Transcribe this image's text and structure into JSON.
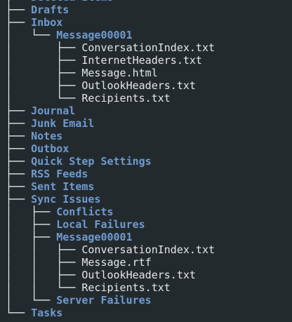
{
  "colors": {
    "background": "#232a2e",
    "directory": "#6f9bd1",
    "file": "#e6e6e6"
  },
  "tree": [
    {
      "prefix": "├── ",
      "name": "Deleted Items",
      "type": "dir"
    },
    {
      "prefix": "├── ",
      "name": "Drafts",
      "type": "dir"
    },
    {
      "prefix": "├── ",
      "name": "Inbox",
      "type": "dir"
    },
    {
      "prefix": "│   └── ",
      "name": "Message00001",
      "type": "dir"
    },
    {
      "prefix": "│       ├── ",
      "name": "ConversationIndex.txt",
      "type": "file"
    },
    {
      "prefix": "│       ├── ",
      "name": "InternetHeaders.txt",
      "type": "file"
    },
    {
      "prefix": "│       ├── ",
      "name": "Message.html",
      "type": "file"
    },
    {
      "prefix": "│       ├── ",
      "name": "OutlookHeaders.txt",
      "type": "file"
    },
    {
      "prefix": "│       └── ",
      "name": "Recipients.txt",
      "type": "file"
    },
    {
      "prefix": "├── ",
      "name": "Journal",
      "type": "dir"
    },
    {
      "prefix": "├── ",
      "name": "Junk Email",
      "type": "dir"
    },
    {
      "prefix": "├── ",
      "name": "Notes",
      "type": "dir"
    },
    {
      "prefix": "├── ",
      "name": "Outbox",
      "type": "dir"
    },
    {
      "prefix": "├── ",
      "name": "Quick Step Settings",
      "type": "dir"
    },
    {
      "prefix": "├── ",
      "name": "RSS Feeds",
      "type": "dir"
    },
    {
      "prefix": "├── ",
      "name": "Sent Items",
      "type": "dir"
    },
    {
      "prefix": "├── ",
      "name": "Sync Issues",
      "type": "dir"
    },
    {
      "prefix": "│   ├── ",
      "name": "Conflicts",
      "type": "dir"
    },
    {
      "prefix": "│   ├── ",
      "name": "Local Failures",
      "type": "dir"
    },
    {
      "prefix": "│   ├── ",
      "name": "Message00001",
      "type": "dir"
    },
    {
      "prefix": "│   │   ├── ",
      "name": "ConversationIndex.txt",
      "type": "file"
    },
    {
      "prefix": "│   │   ├── ",
      "name": "Message.rtf",
      "type": "file"
    },
    {
      "prefix": "│   │   ├── ",
      "name": "OutlookHeaders.txt",
      "type": "file"
    },
    {
      "prefix": "│   │   └── ",
      "name": "Recipients.txt",
      "type": "file"
    },
    {
      "prefix": "│   └── ",
      "name": "Server Failures",
      "type": "dir"
    },
    {
      "prefix": "└── ",
      "name": "Tasks",
      "type": "dir"
    }
  ]
}
